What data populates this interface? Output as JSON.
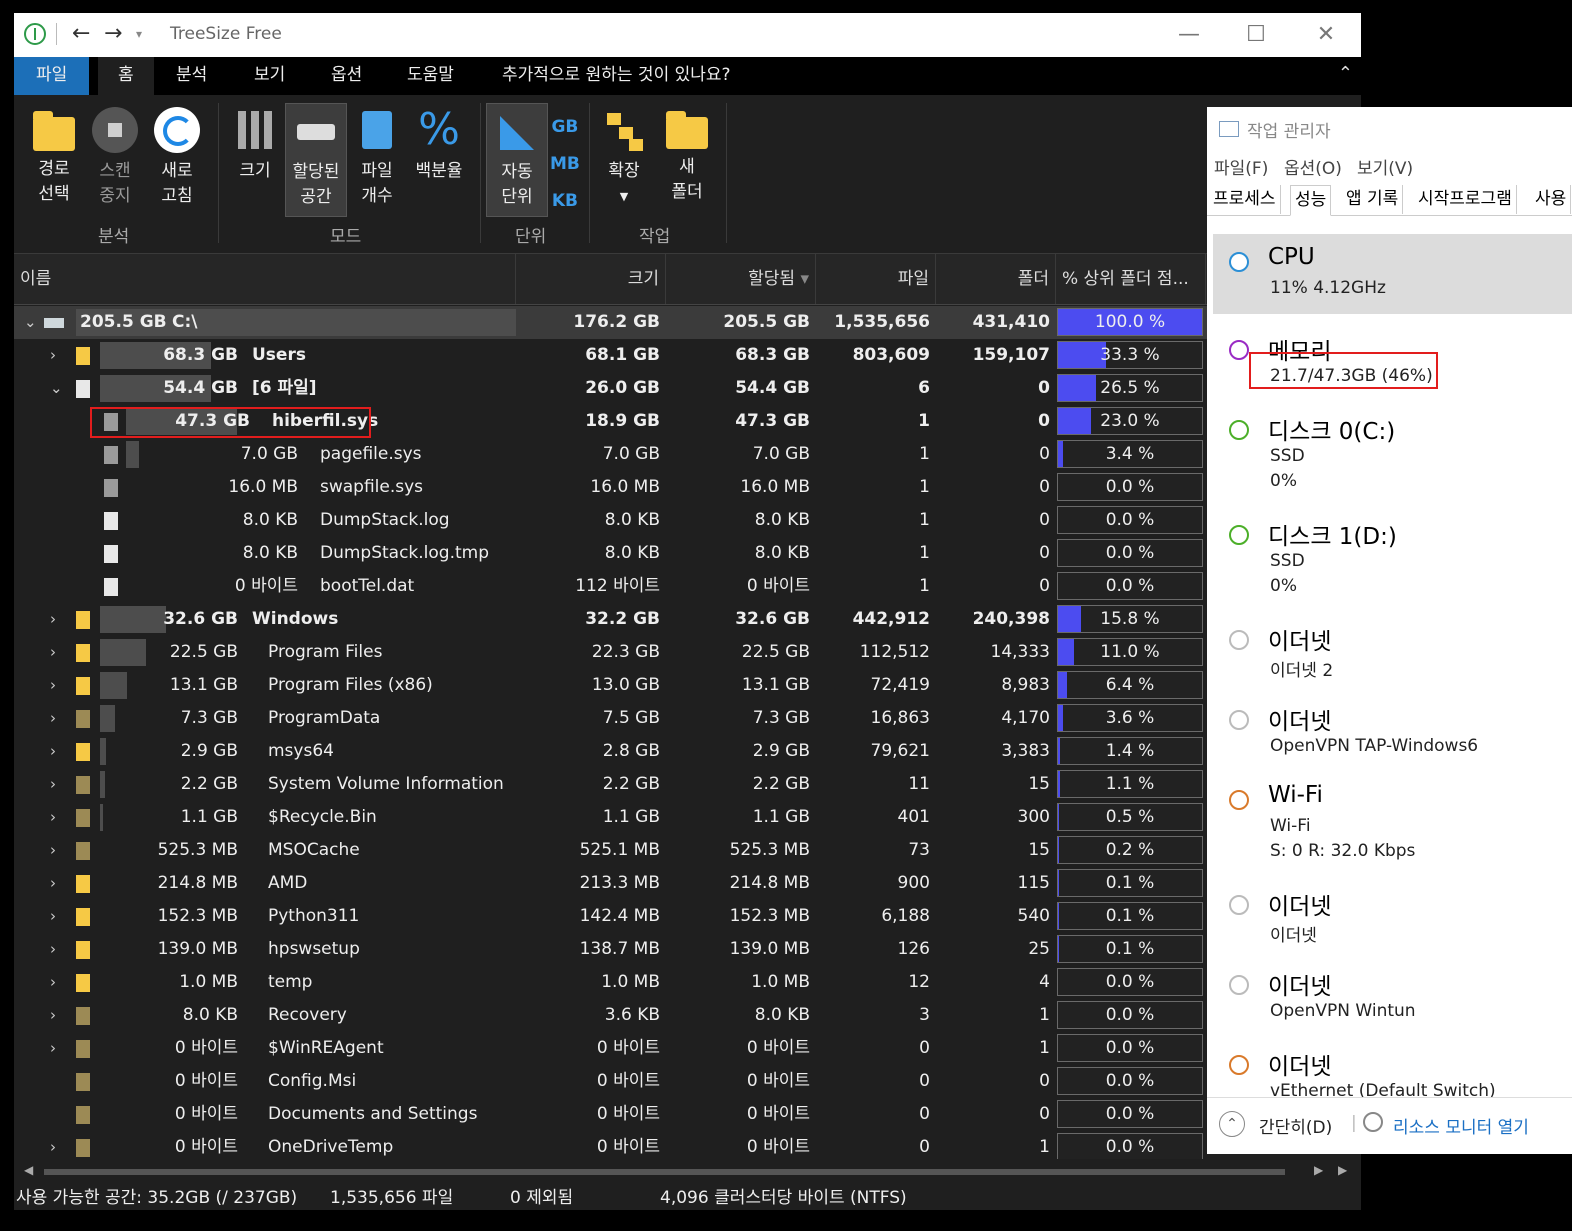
{
  "window": {
    "title": "TreeSize Free",
    "menus": [
      "파일",
      "홈",
      "분석",
      "보기",
      "옵션",
      "도움말",
      "추가적으로 원하는 것이 있나요?"
    ]
  },
  "ribbon": {
    "buttons": {
      "path_select": "경로\n선택",
      "scan_stop": "스캔\n중지",
      "refresh": "새로\n고침",
      "size": "크기",
      "allocated": "할당된\n공간",
      "file_count": "파일\n개수",
      "percent": "백분율",
      "auto_unit": "자동\n단위",
      "expand": "확장",
      "new_folder": "새\n폴더"
    },
    "units": [
      "GB",
      "MB",
      "KB"
    ],
    "groups": [
      "분석",
      "모드",
      "단위",
      "작업"
    ]
  },
  "columns": [
    "이름",
    "크기",
    "할당됨",
    "파일",
    "폴더",
    "% 상위 폴더 점..."
  ],
  "rows": [
    {
      "label": "205.5 GB   C:\\",
      "size": "176.2 GB",
      "alloc": "205.5 GB",
      "files": "1,535,656",
      "folders": "431,410",
      "pct_text": "100.0 %",
      "pct": 100,
      "indent": 0,
      "icon": "drive",
      "exp": "v",
      "bold": true,
      "root": true,
      "bar": 1.0
    },
    {
      "label": "68.3 GB   Users",
      "size": "68.1 GB",
      "alloc": "68.3 GB",
      "files": "803,609",
      "folders": "159,107",
      "pct_text": "33.3 %",
      "pct": 33.3,
      "indent": 1,
      "icon": "folder",
      "exp": ">",
      "bold": true,
      "bar": 0.333
    },
    {
      "label": "54.4 GB   [6 파일]",
      "size": "26.0 GB",
      "alloc": "54.4 GB",
      "files": "6",
      "folders": "0",
      "pct_text": "26.5 %",
      "pct": 26.5,
      "indent": 1,
      "icon": "file",
      "exp": "v",
      "bold": true,
      "bar": 0.265
    },
    {
      "label": "47.3 GB   hiberfil.sys",
      "size": "18.9 GB",
      "alloc": "47.3 GB",
      "files": "1",
      "folders": "0",
      "pct_text": "23.0 %",
      "pct": 23.0,
      "indent": 2,
      "icon": "sys",
      "exp": "",
      "bold": true,
      "bar": 0.23
    },
    {
      "label": "7.0 GB   pagefile.sys",
      "size": "7.0 GB",
      "alloc": "7.0 GB",
      "files": "1",
      "folders": "0",
      "pct_text": "3.4 %",
      "pct": 3.4,
      "indent": 2,
      "icon": "sys",
      "exp": "",
      "bar": 0.034
    },
    {
      "label": "16.0 MB   swapfile.sys",
      "size": "16.0 MB",
      "alloc": "16.0 MB",
      "files": "1",
      "folders": "0",
      "pct_text": "0.0 %",
      "pct": 0,
      "indent": 2,
      "icon": "sys",
      "exp": "",
      "bar": 0
    },
    {
      "label": "8.0 KB   DumpStack.log",
      "size": "8.0 KB",
      "alloc": "8.0 KB",
      "files": "1",
      "folders": "0",
      "pct_text": "0.0 %",
      "pct": 0,
      "indent": 2,
      "icon": "file",
      "exp": "",
      "bar": 0
    },
    {
      "label": "8.0 KB   DumpStack.log.tmp",
      "size": "8.0 KB",
      "alloc": "8.0 KB",
      "files": "1",
      "folders": "0",
      "pct_text": "0.0 %",
      "pct": 0,
      "indent": 2,
      "icon": "file",
      "exp": "",
      "bar": 0
    },
    {
      "label": "0 바이트   bootTel.dat",
      "size": "112 바이트",
      "alloc": "0 바이트",
      "files": "1",
      "folders": "0",
      "pct_text": "0.0 %",
      "pct": 0,
      "indent": 2,
      "icon": "file",
      "exp": "",
      "bar": 0
    },
    {
      "label": "32.6 GB   Windows",
      "size": "32.2 GB",
      "alloc": "32.6 GB",
      "files": "442,912",
      "folders": "240,398",
      "pct_text": "15.8 %",
      "pct": 15.8,
      "indent": 1,
      "icon": "folder",
      "exp": ">",
      "bold": true,
      "bar": 0.158
    },
    {
      "label": "22.5 GB   Program Files",
      "size": "22.3 GB",
      "alloc": "22.5 GB",
      "files": "112,512",
      "folders": "14,333",
      "pct_text": "11.0 %",
      "pct": 11.0,
      "indent": 1,
      "icon": "folder",
      "exp": ">",
      "bar": 0.11
    },
    {
      "label": "13.1 GB   Program Files (x86)",
      "size": "13.0 GB",
      "alloc": "13.1 GB",
      "files": "72,419",
      "folders": "8,983",
      "pct_text": "6.4 %",
      "pct": 6.4,
      "indent": 1,
      "icon": "folder",
      "exp": ">",
      "bar": 0.064
    },
    {
      "label": "7.3 GB   ProgramData",
      "size": "7.5 GB",
      "alloc": "7.3 GB",
      "files": "16,863",
      "folders": "4,170",
      "pct_text": "3.6 %",
      "pct": 3.6,
      "indent": 1,
      "icon": "folderdim",
      "exp": ">",
      "bar": 0.036
    },
    {
      "label": "2.9 GB   msys64",
      "size": "2.8 GB",
      "alloc": "2.9 GB",
      "files": "79,621",
      "folders": "3,383",
      "pct_text": "1.4 %",
      "pct": 1.4,
      "indent": 1,
      "icon": "folder",
      "exp": ">",
      "bar": 0.014
    },
    {
      "label": "2.2 GB   System Volume Information",
      "size": "2.2 GB",
      "alloc": "2.2 GB",
      "files": "11",
      "folders": "15",
      "pct_text": "1.1 %",
      "pct": 1.1,
      "indent": 1,
      "icon": "folderdim",
      "exp": ">",
      "bar": 0.011
    },
    {
      "label": "1.1 GB   $Recycle.Bin",
      "size": "1.1 GB",
      "alloc": "1.1 GB",
      "files": "401",
      "folders": "300",
      "pct_text": "0.5 %",
      "pct": 0.5,
      "indent": 1,
      "icon": "folderdim",
      "exp": ">",
      "bar": 0.005
    },
    {
      "label": "525.3 MB   MSOCache",
      "size": "525.1 MB",
      "alloc": "525.3 MB",
      "files": "73",
      "folders": "15",
      "pct_text": "0.2 %",
      "pct": 0.2,
      "indent": 1,
      "icon": "folderdim",
      "exp": ">",
      "bar": 0
    },
    {
      "label": "214.8 MB   AMD",
      "size": "213.3 MB",
      "alloc": "214.8 MB",
      "files": "900",
      "folders": "115",
      "pct_text": "0.1 %",
      "pct": 0.1,
      "indent": 1,
      "icon": "folder",
      "exp": ">",
      "bar": 0
    },
    {
      "label": "152.3 MB   Python311",
      "size": "142.4 MB",
      "alloc": "152.3 MB",
      "files": "6,188",
      "folders": "540",
      "pct_text": "0.1 %",
      "pct": 0.1,
      "indent": 1,
      "icon": "folder",
      "exp": ">",
      "bar": 0
    },
    {
      "label": "139.0 MB   hpswsetup",
      "size": "138.7 MB",
      "alloc": "139.0 MB",
      "files": "126",
      "folders": "25",
      "pct_text": "0.1 %",
      "pct": 0.1,
      "indent": 1,
      "icon": "folder",
      "exp": ">",
      "bar": 0
    },
    {
      "label": "1.0 MB   temp",
      "size": "1.0 MB",
      "alloc": "1.0 MB",
      "files": "12",
      "folders": "4",
      "pct_text": "0.0 %",
      "pct": 0,
      "indent": 1,
      "icon": "folder",
      "exp": ">",
      "bar": 0
    },
    {
      "label": "8.0 KB   Recovery",
      "size": "3.6 KB",
      "alloc": "8.0 KB",
      "files": "3",
      "folders": "1",
      "pct_text": "0.0 %",
      "pct": 0,
      "indent": 1,
      "icon": "folderdim",
      "exp": ">",
      "bar": 0
    },
    {
      "label": "0 바이트   $WinREAgent",
      "size": "0 바이트",
      "alloc": "0 바이트",
      "files": "0",
      "folders": "1",
      "pct_text": "0.0 %",
      "pct": 0,
      "indent": 1,
      "icon": "folderdim",
      "exp": ">",
      "bar": 0
    },
    {
      "label": "0 바이트   Config.Msi",
      "size": "0 바이트",
      "alloc": "0 바이트",
      "files": "0",
      "folders": "0",
      "pct_text": "0.0 %",
      "pct": 0,
      "indent": 1,
      "icon": "folderdim",
      "exp": "",
      "bar": 0
    },
    {
      "label": "0 바이트   Documents and Settings",
      "size": "0 바이트",
      "alloc": "0 바이트",
      "files": "0",
      "folders": "0",
      "pct_text": "0.0 %",
      "pct": 0,
      "indent": 1,
      "icon": "folderdim",
      "exp": "",
      "bar": 0
    },
    {
      "label": "0 바이트   OneDriveTemp",
      "size": "0 바이트",
      "alloc": "0 바이트",
      "files": "0",
      "folders": "1",
      "pct_text": "0.0 %",
      "pct": 0,
      "indent": 1,
      "icon": "folderdim",
      "exp": ">",
      "bar": 0
    }
  ],
  "status": {
    "free": "사용 가능한 공간: 35.2GB   (/ 237GB)",
    "files": "1,535,656 파일",
    "excluded": "0 제외됨",
    "cluster": "4,096 클러스터당 바이트 (NTFS)"
  },
  "task_manager": {
    "title": "작업 관리자",
    "menus": [
      "파일(F)",
      "옵션(O)",
      "보기(V)"
    ],
    "tabs": [
      "프로세스",
      "성능",
      "앱 기록",
      "시작프로그램",
      "사용"
    ],
    "items": [
      {
        "name": "CPU",
        "sub": "11%  4.12GHz",
        "sub2": "",
        "color": "#2b8fd6"
      },
      {
        "name": "메모리",
        "sub": "21.7/47.3GB (46%)",
        "sub2": "",
        "color": "#9a2bc4"
      },
      {
        "name": "디스크 0(C:)",
        "sub": "SSD",
        "sub2": "0%",
        "color": "#4caf29"
      },
      {
        "name": "디스크 1(D:)",
        "sub": "SSD",
        "sub2": "0%",
        "color": "#4caf29"
      },
      {
        "name": "이더넷",
        "sub": "이더넷 2",
        "sub2": "",
        "color": "#bbbbbb"
      },
      {
        "name": "이더넷",
        "sub": "OpenVPN TAP-Windows6",
        "sub2": "",
        "color": "#bbbbbb"
      },
      {
        "name": "Wi-Fi",
        "sub": "Wi-Fi",
        "sub2": "S: 0  R: 32.0 Kbps",
        "color": "#d97a2b"
      },
      {
        "name": "이더넷",
        "sub": "이더넷",
        "sub2": "",
        "color": "#bbbbbb"
      },
      {
        "name": "이더넷",
        "sub": "OpenVPN Wintun",
        "sub2": "",
        "color": "#bbbbbb"
      },
      {
        "name": "이더넷",
        "sub": "vEthernet (Default Switch)",
        "sub2": "",
        "color": "#d97a2b"
      }
    ],
    "footer": {
      "less": "간단히(D)",
      "monitor": "리소스 모니터 열기"
    }
  },
  "colors": {
    "accent": "#1c6fb8",
    "bar": "#4c4cf0",
    "highlight": "#e21d1d"
  }
}
